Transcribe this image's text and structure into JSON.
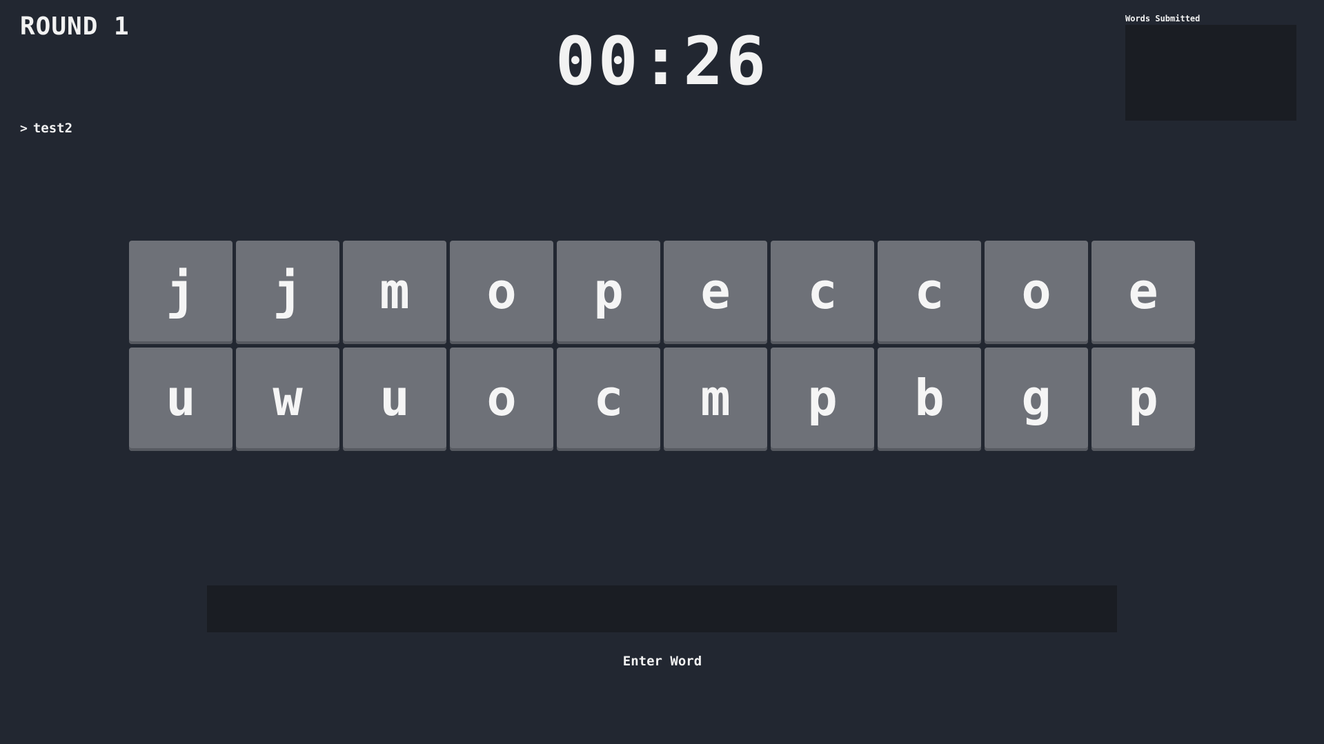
{
  "header": {
    "round_label": "ROUND 1",
    "timer": "00:26"
  },
  "players": [
    {
      "name": "test2",
      "indicator": "chevron-right-icon"
    }
  ],
  "words_panel": {
    "title": "Words Submitted",
    "words": []
  },
  "board": {
    "rows": [
      [
        "j",
        "j",
        "m",
        "o",
        "p",
        "e",
        "c",
        "c",
        "o",
        "e"
      ],
      [
        "u",
        "w",
        "u",
        "o",
        "c",
        "m",
        "p",
        "b",
        "g",
        "p"
      ]
    ]
  },
  "input": {
    "value": "",
    "placeholder": ""
  },
  "enter_button": {
    "label": "Enter Word"
  },
  "colors": {
    "background": "#222731",
    "tile": "#6e7178",
    "panel": "#1a1d23",
    "text": "#f2f2f2"
  }
}
